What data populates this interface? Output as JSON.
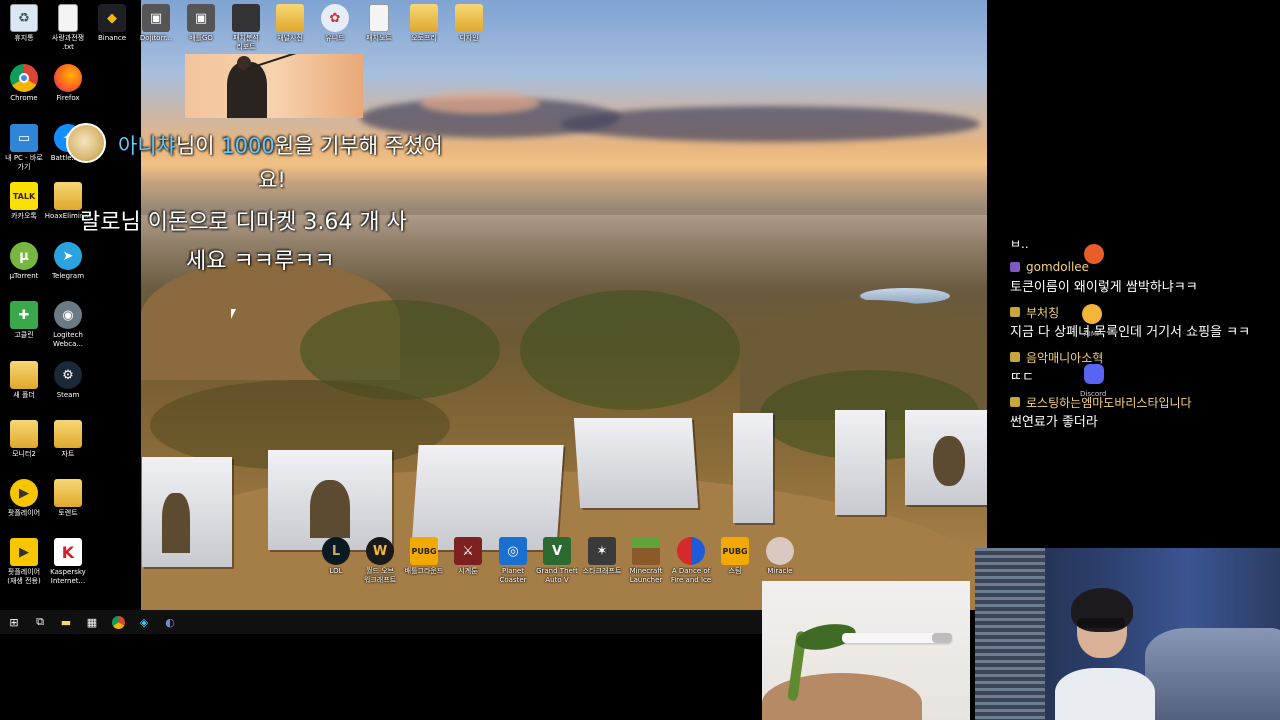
{
  "desktop": {
    "icons_col1": [
      {
        "label": "휴지통",
        "icon": "recycle-bin-icon"
      },
      {
        "label": "Chrome",
        "icon": "chrome-icon"
      },
      {
        "label": "내 PC - 바로\n가기",
        "icon": "pc-icon"
      },
      {
        "label": "카카오톡",
        "icon": "kakaotalk-icon"
      },
      {
        "label": "μTorrent",
        "icon": "utorrent-icon"
      },
      {
        "label": "고클린",
        "icon": "goclean-icon"
      },
      {
        "label": "새 폴더",
        "icon": "folder-icon"
      },
      {
        "label": "모니터2",
        "icon": "folder-icon"
      },
      {
        "label": "팟플레이어",
        "icon": "potplayer-icon"
      },
      {
        "label": "팟플레이어\n(재생 전용)",
        "icon": "potplayer-icon"
      }
    ],
    "icons_col2": [
      {
        "label": "사랑과전쟁\n.txt",
        "icon": "text-file-icon"
      },
      {
        "label": "Firefox",
        "icon": "firefox-icon"
      },
      {
        "label": "Battle.net",
        "icon": "battlenet-icon"
      },
      {
        "label": "HoaxEliminat",
        "icon": "app-icon"
      },
      {
        "label": "Telegram",
        "icon": "telegram-icon"
      },
      {
        "label": "Logitech\nWebca...",
        "icon": "webcam-icon"
      },
      {
        "label": "Steam",
        "icon": "steam-icon"
      },
      {
        "label": "자트",
        "icon": "file-icon"
      },
      {
        "label": "토렌트",
        "icon": "folder-icon"
      },
      {
        "label": "Kaspersky\nInternet...",
        "icon": "kaspersky-icon"
      }
    ],
    "top_row": [
      {
        "label": "Binance",
        "icon": "binance-icon"
      },
      {
        "label": "Dojitorr...",
        "icon": "app-icon"
      },
      {
        "label": "배틀GO",
        "icon": "app-icon"
      },
      {
        "label": "패치분석\n리포트",
        "icon": "file-icon"
      },
      {
        "label": "채널사진",
        "icon": "folder-icon"
      },
      {
        "label": "유니드",
        "icon": "app-icon"
      },
      {
        "label": "패치노트",
        "icon": "text-file-icon"
      },
      {
        "label": "오토프리",
        "icon": "folder-icon"
      },
      {
        "label": "디자인",
        "icon": "folder-icon"
      }
    ],
    "bottom_row": [
      {
        "label": "LOL",
        "icon": "lol-icon"
      },
      {
        "label": "월드 오브\n워크래프트",
        "icon": "wow-icon"
      },
      {
        "label": "배틀그라운드",
        "icon": "pubg-icon"
      },
      {
        "label": "시계툰",
        "icon": "app-icon"
      },
      {
        "label": "Planet\nCoaster",
        "icon": "planet-coaster-icon"
      },
      {
        "label": "Grand Theft\nAuto V",
        "icon": "gta-icon"
      },
      {
        "label": "스타크래프트",
        "icon": "starcraft-icon"
      },
      {
        "label": "Minecraft\nLauncher",
        "icon": "minecraft-icon"
      },
      {
        "label": "A Dance of\nFire and Ice",
        "icon": "adofai-icon"
      },
      {
        "label": "스팀",
        "icon": "pubg-icon"
      },
      {
        "label": "Miracle",
        "icon": "app-icon"
      }
    ]
  },
  "donation": {
    "donor": "아니챠",
    "line1_pre": "님이 ",
    "amount": "1000",
    "line1_post": "원을 기부해 주셨어",
    "line2": "요!",
    "message_line1": "랄로님 이돈으로 디마켓 3.64 개 사",
    "message_line2": "세요 ㅋㅋ루ㅋㅋ"
  },
  "chat": {
    "first_text": "ㅂ..",
    "messages": [
      {
        "user": "gomdollee",
        "badge": "twitch",
        "text": "토큰이름이 왜이렇게 쌈박하냐ㅋㅋ"
      },
      {
        "user": "부처칭",
        "badge": "chat",
        "text": "지금 다 상폐녀 목록인데 거기서 쇼핑을 ㅋㅋ"
      },
      {
        "user": "음악매니아소혁",
        "badge": "chat",
        "text": "ㄸㄷ"
      },
      {
        "user": "로스팅하는엠마도바리스타입니다",
        "badge": "chat",
        "text": "썬연료가 좋더라"
      }
    ],
    "side_apps": [
      {
        "label": "AIMP",
        "icon": "aimp-icon"
      },
      {
        "label": "Discord",
        "icon": "discord-icon"
      }
    ]
  },
  "taskbar": {
    "items": [
      "start-icon",
      "task-view-icon",
      "file-explorer-icon",
      "calculator-icon",
      "chrome-icon",
      "app-icon",
      "discord-icon"
    ]
  }
}
